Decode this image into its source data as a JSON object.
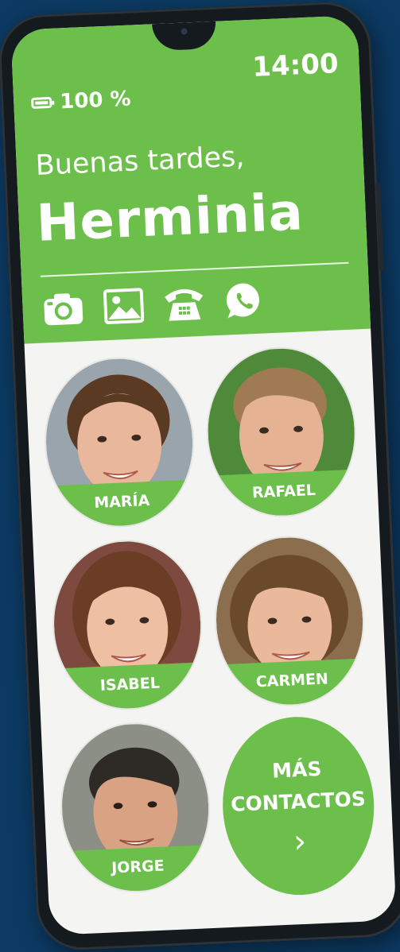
{
  "status_bar": {
    "battery": "100 %",
    "time": "14:00"
  },
  "greeting": {
    "salutation": "Buenas tardes,",
    "name": "Herminia"
  },
  "apps": [
    "camera-icon",
    "gallery-icon",
    "phone-icon",
    "whatsapp-icon"
  ],
  "contacts": [
    {
      "name": "MARÍA",
      "bg": "#9aa4ad",
      "hair": "#5a3a22",
      "skin": "#e9b79b"
    },
    {
      "name": "RAFAEL",
      "bg": "#4f8a3a",
      "hair": "#a07a52",
      "skin": "#e5b394"
    },
    {
      "name": "ISABEL",
      "bg": "#7e4a3f",
      "hair": "#6b3d24",
      "skin": "#eebfa2"
    },
    {
      "name": "CARMEN",
      "bg": "#8a6e4e",
      "hair": "#6a4a2b",
      "skin": "#eab89a"
    },
    {
      "name": "JORGE",
      "bg": "#8b8f86",
      "hair": "#2e2a26",
      "skin": "#d9a383"
    }
  ],
  "more_contacts": {
    "line1": "MÁS",
    "line2": "CONTACTOS",
    "chevron": "›"
  },
  "colors": {
    "accent": "#6dbf4b",
    "background": "#0c3a63",
    "screen": "#f4f4f2"
  }
}
